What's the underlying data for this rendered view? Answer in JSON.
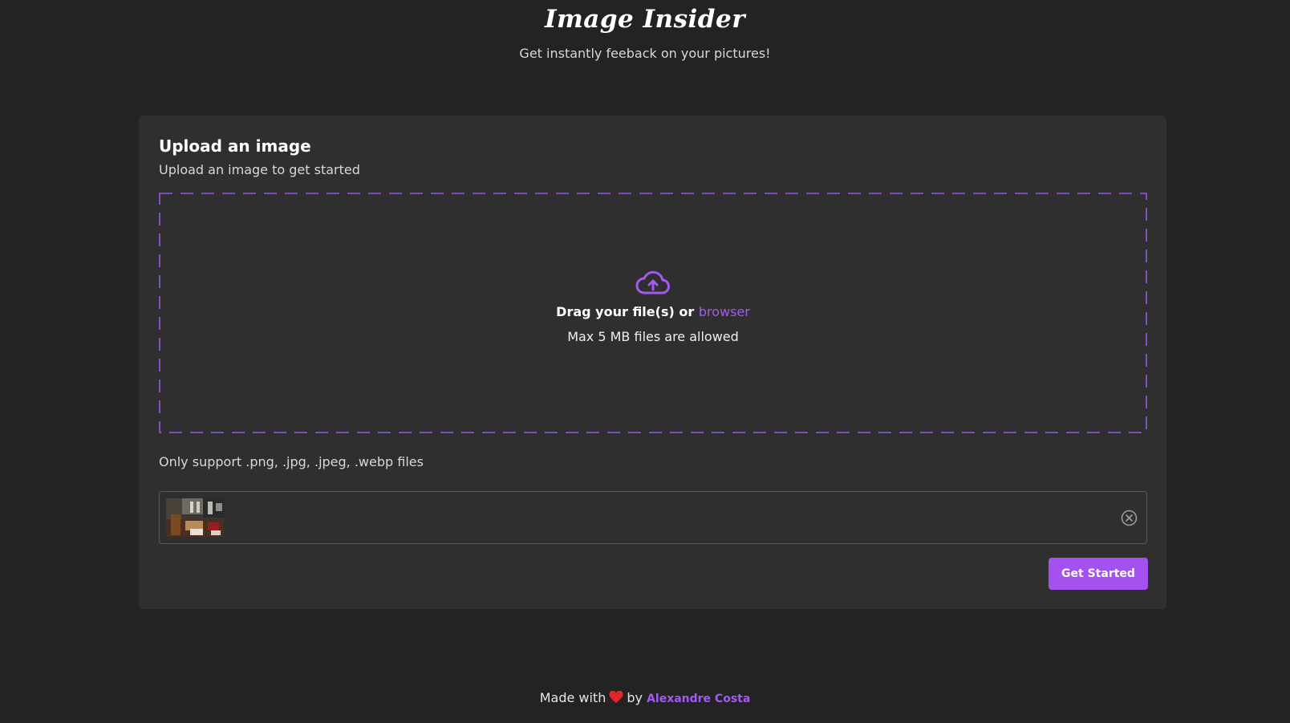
{
  "header": {
    "title": "Image Insider",
    "subtitle": "Get instantly feeback on your pictures!"
  },
  "upload_card": {
    "title": "Upload an image",
    "description": "Upload an image to get started",
    "dropzone": {
      "prompt_prefix": "Drag your file(s) or",
      "browse_link": "browser",
      "limit_text": "Max 5 MB files are allowed",
      "icon": "cloud-upload-icon"
    },
    "support_note": "Only support .png, .jpg, .jpeg, .webp files",
    "selected_file": {
      "thumbnail": "uploaded-image-thumbnail",
      "remove_icon": "close-circle-icon"
    },
    "submit_label": "Get Started"
  },
  "footer": {
    "made_with": "Made with",
    "icon": "heart-icon",
    "by": "by",
    "author": "Alexandre Costa"
  },
  "colors": {
    "background": "#232323",
    "card": "#2f2f2f",
    "accent": "#a352f0",
    "heart": "#e0262b"
  }
}
